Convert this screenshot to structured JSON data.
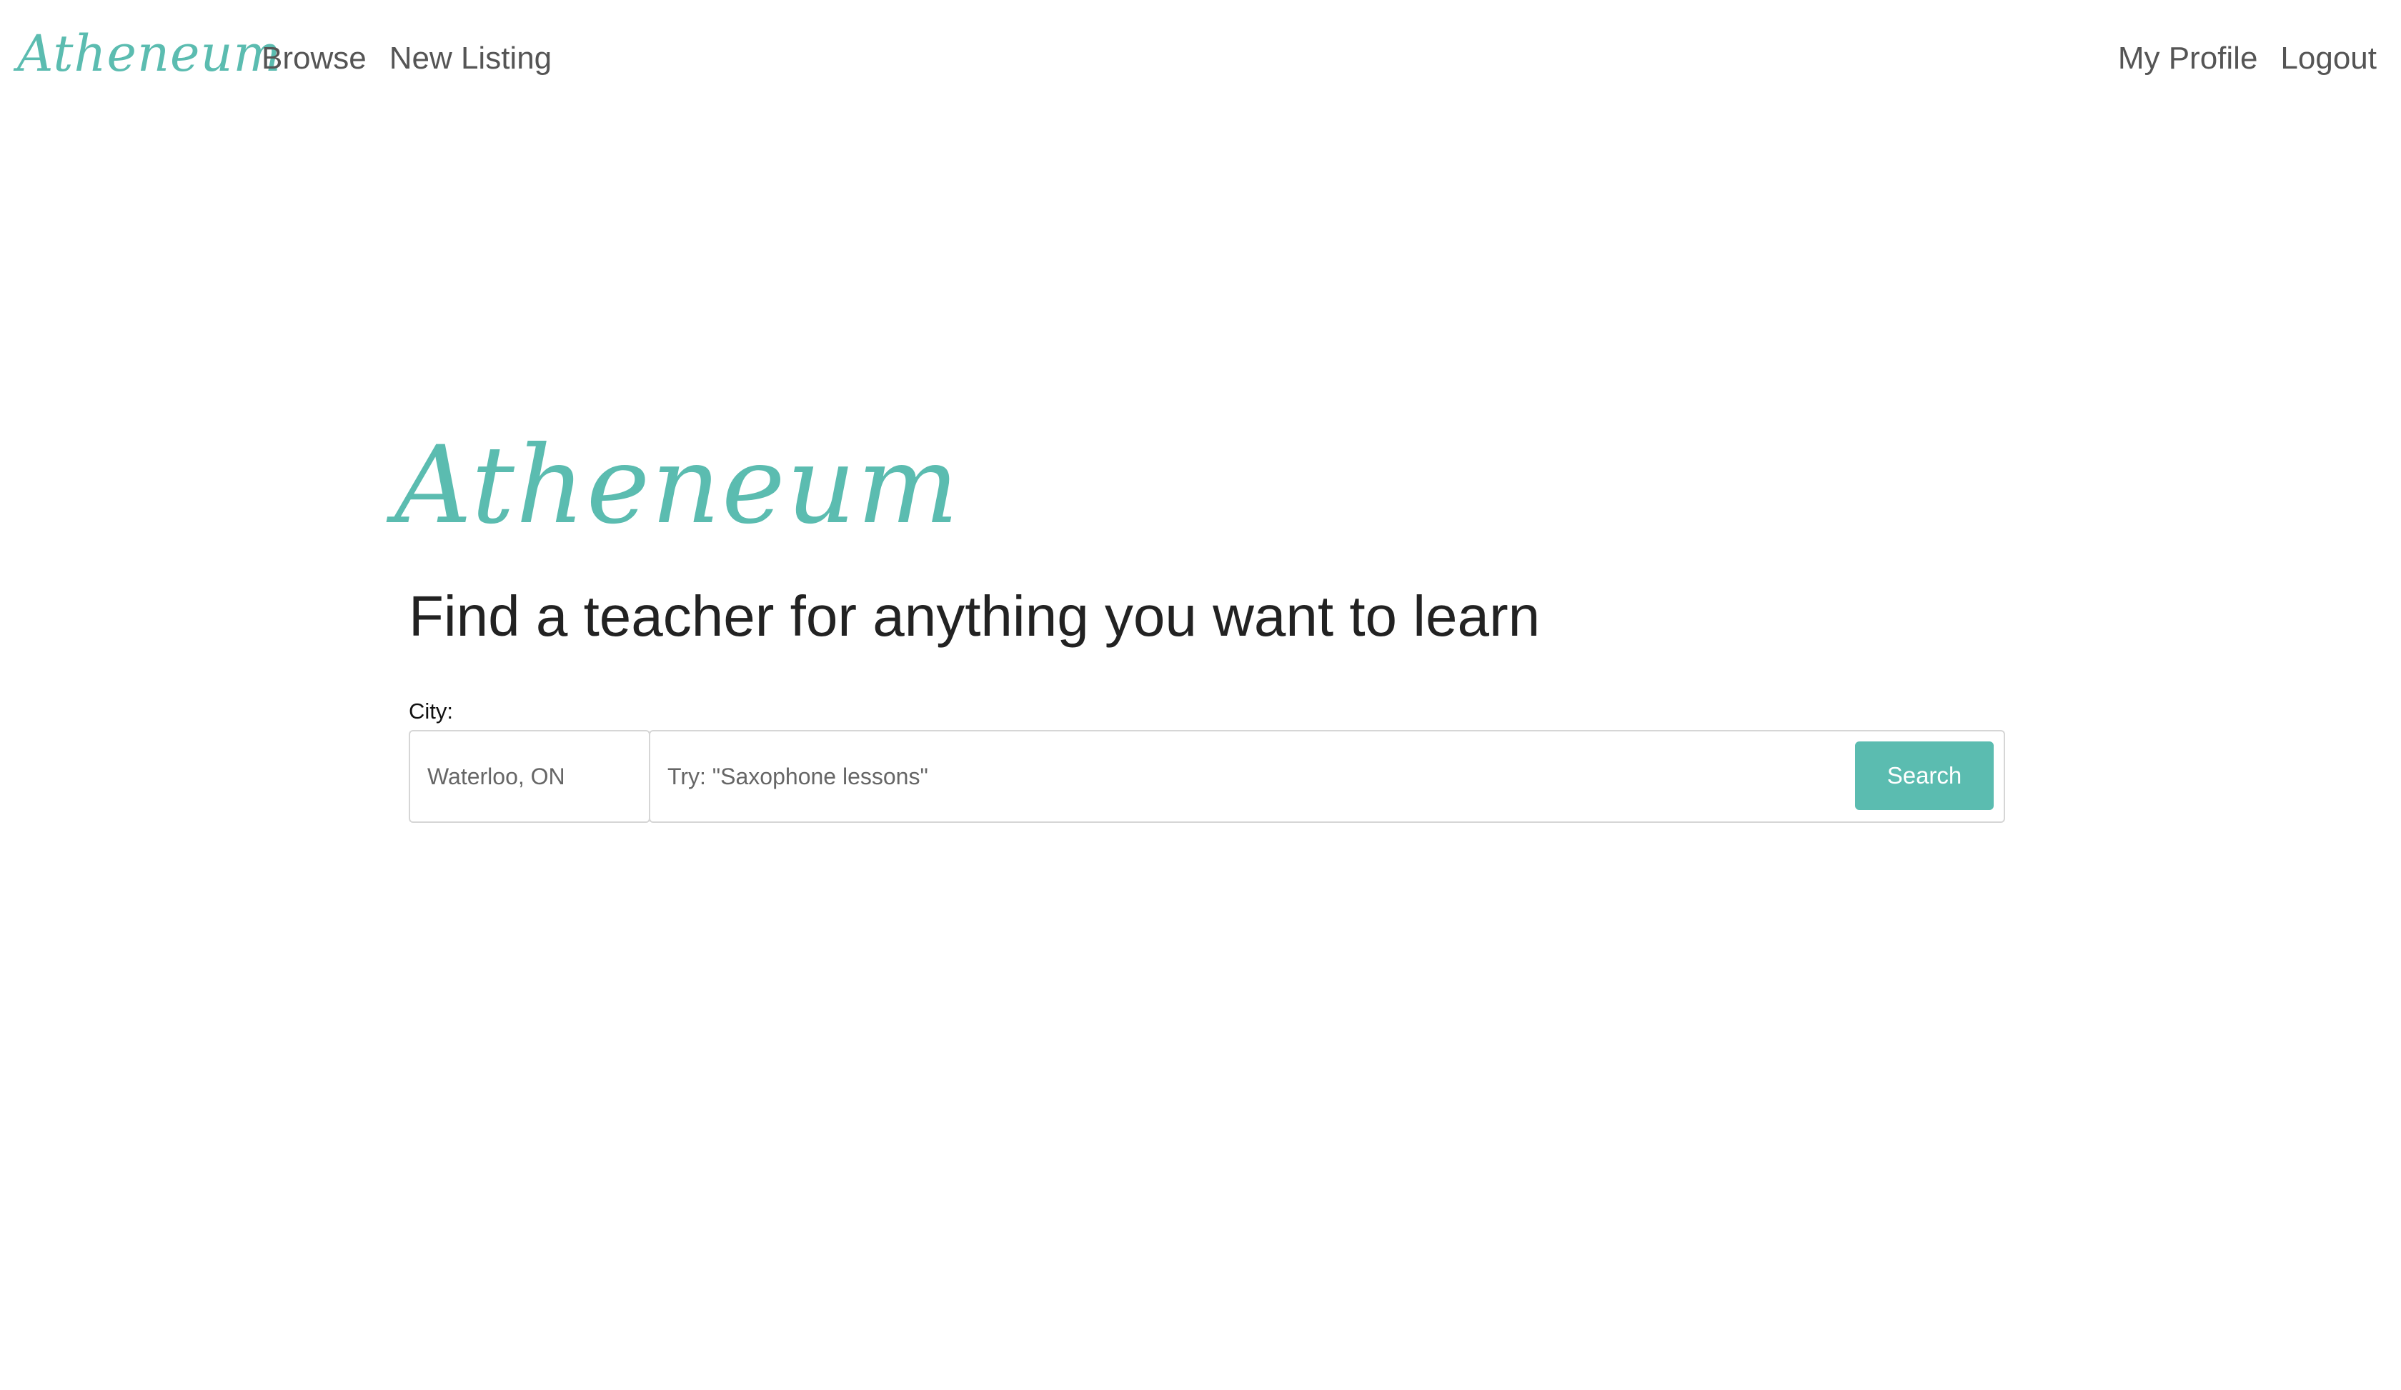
{
  "navbar": {
    "brand": "Atheneum",
    "left_links": [
      {
        "label": "Browse"
      },
      {
        "label": "New Listing"
      }
    ],
    "right_links": [
      {
        "label": "My Profile"
      },
      {
        "label": "Logout"
      }
    ]
  },
  "hero": {
    "logo_text": "Atheneum",
    "heading": "Find a teacher for anything you want to learn"
  },
  "search_form": {
    "city_label": "City:",
    "city_placeholder": "Waterloo, ON",
    "query_placeholder": "Try: \"Saxophone lessons\"",
    "search_button_label": "Search"
  },
  "colors": {
    "brand_teal": "#5bbcb0",
    "nav_text": "#555555",
    "heading_text": "#222222",
    "input_border": "#d6d6d6"
  }
}
